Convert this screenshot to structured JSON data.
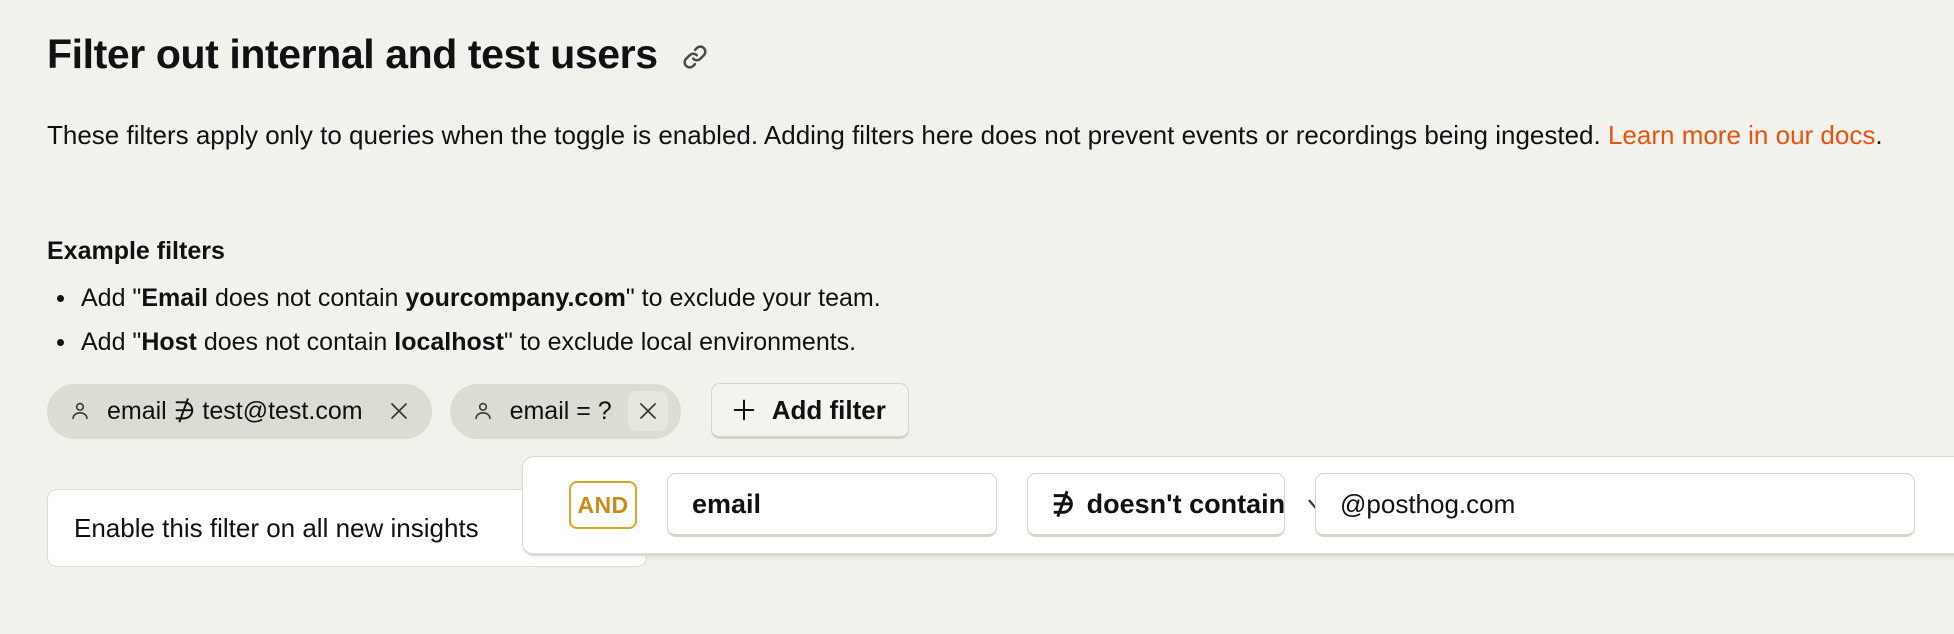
{
  "header": {
    "title": "Filter out internal and test users",
    "link_icon": "link-icon"
  },
  "description": {
    "text_before_link": "These filters apply only to queries when the toggle is enabled. Adding filters here does not prevent events or recordings being ingested. ",
    "link_text": "Learn more in our docs",
    "text_after_link": "."
  },
  "examples": {
    "heading": "Example filters",
    "items": [
      {
        "prefix": "Add \"",
        "bold_1": "Email",
        "middle": " does not contain ",
        "bold_2": "yourcompany.com",
        "suffix": "\" to exclude your team."
      },
      {
        "prefix": "Add \"",
        "bold_1": "Host",
        "middle": " does not contain ",
        "bold_2": "localhost",
        "suffix": "\" to exclude local environments."
      }
    ]
  },
  "filters": {
    "pills": [
      {
        "icon": "person-icon",
        "label": "email ∌ test@test.com",
        "close_label": "✕",
        "close_active": false
      },
      {
        "icon": "person-icon",
        "label": "email = ?",
        "close_label": "✕",
        "close_active": true
      }
    ],
    "add_filter_label": "Add filter",
    "plus_icon": "plus-icon"
  },
  "enable_toggle": {
    "label": "Enable this filter on all new insights"
  },
  "filter_editor": {
    "logic_operator": "AND",
    "property_value": "email",
    "operator_symbol": "∌",
    "operator_label": "doesn't contain",
    "chevron_icon": "chevron-down-icon",
    "value": "@posthog.com"
  },
  "colors": {
    "background": "#f2f2ed",
    "accent_link": "#e8530e",
    "and_badge_border": "#dba622",
    "and_badge_text": "#c98d1b",
    "pill_background": "#dcdcd4",
    "text": "#111013"
  }
}
